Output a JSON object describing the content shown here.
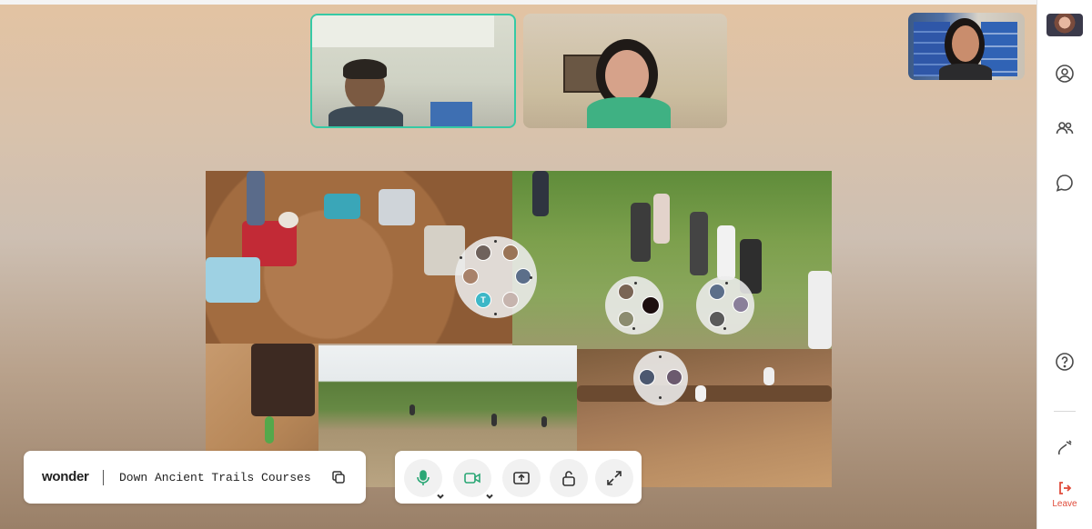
{
  "room": {
    "brand": "wonder",
    "name": "Down Ancient Trails Courses"
  },
  "controls": {
    "microphone": "microphone-icon",
    "camera": "camera-icon",
    "share": "screen-share-icon",
    "lock": "lock-icon",
    "fullscreen": "fullscreen-icon"
  },
  "sidebar": {
    "leave_label": "Leave"
  },
  "colors": {
    "active_speaker": "#36c9a5",
    "leave": "#e04b3a",
    "avatar_teal": "#3db7c7"
  },
  "huddles": [
    {
      "avatar_initial": "T"
    }
  ]
}
